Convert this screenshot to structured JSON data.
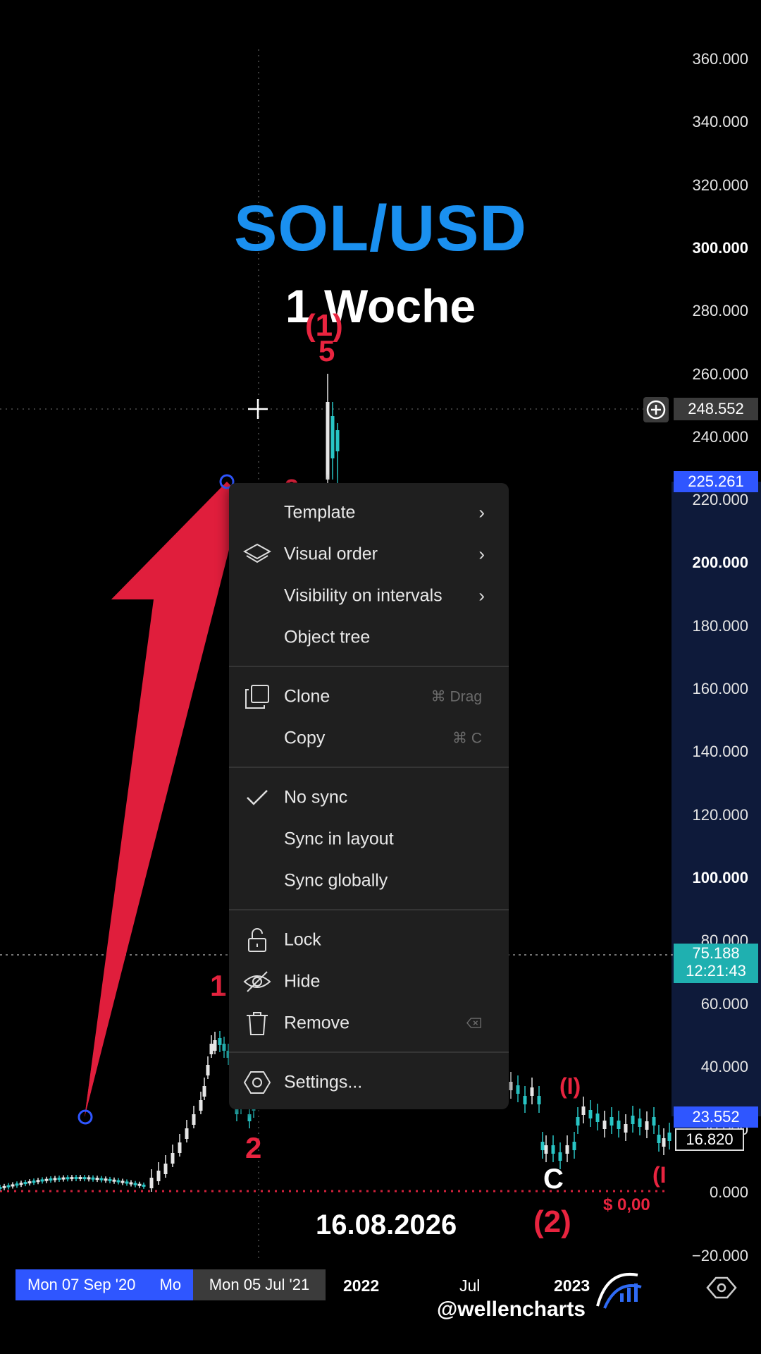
{
  "header": {
    "pair": "SOL/USD",
    "interval": "1 Woche"
  },
  "price_axis": [
    "360.000",
    "340.000",
    "320.000",
    "300.000",
    "280.000",
    "260.000",
    "240.000",
    "220.000",
    "200.000",
    "180.000",
    "160.000",
    "140.000",
    "120.000",
    "100.000",
    "80.000",
    "60.000",
    "40.000",
    "20.000",
    "0.000",
    "−20.000"
  ],
  "price_tags": {
    "crosshair_price": "248.552",
    "selected_upper": "225.261",
    "last_price": "75.188",
    "countdown": "12:21:43",
    "selected_lower": "23.552",
    "other_price": "16.820"
  },
  "colors": {
    "accent_blue": "#2f6bf5",
    "wave_red": "#e8243f",
    "teal": "#28c5c5",
    "title_blue": "#1a90f0"
  },
  "wave_labels": {
    "top_1": "(1)",
    "top_5": "5",
    "top_3": "3",
    "w1": "1",
    "w2": "2",
    "c": "C",
    "wave2": "(2)",
    "right_i": "(I)",
    "right_edge": "(I"
  },
  "zero_line_label": "$ 0,00",
  "date_overlay": "16.08.2026",
  "time_axis": {
    "start_box": "Mon 07 Sep '20",
    "start_box_cut": "Mo",
    "cursor_box": "Mon 05 Jul '21",
    "labels": [
      "2022",
      "Jul",
      "2023"
    ]
  },
  "watermark": "@wellencharts",
  "context_menu": {
    "template": "Template",
    "visual_order": "Visual order",
    "visibility": "Visibility on intervals",
    "object_tree": "Object tree",
    "clone": "Clone",
    "clone_shortcut": "⌘ Drag",
    "copy": "Copy",
    "copy_shortcut": "⌘ C",
    "no_sync": "No sync",
    "sync_layout": "Sync in layout",
    "sync_global": "Sync globally",
    "lock": "Lock",
    "hide": "Hide",
    "remove": "Remove",
    "settings": "Settings..."
  }
}
